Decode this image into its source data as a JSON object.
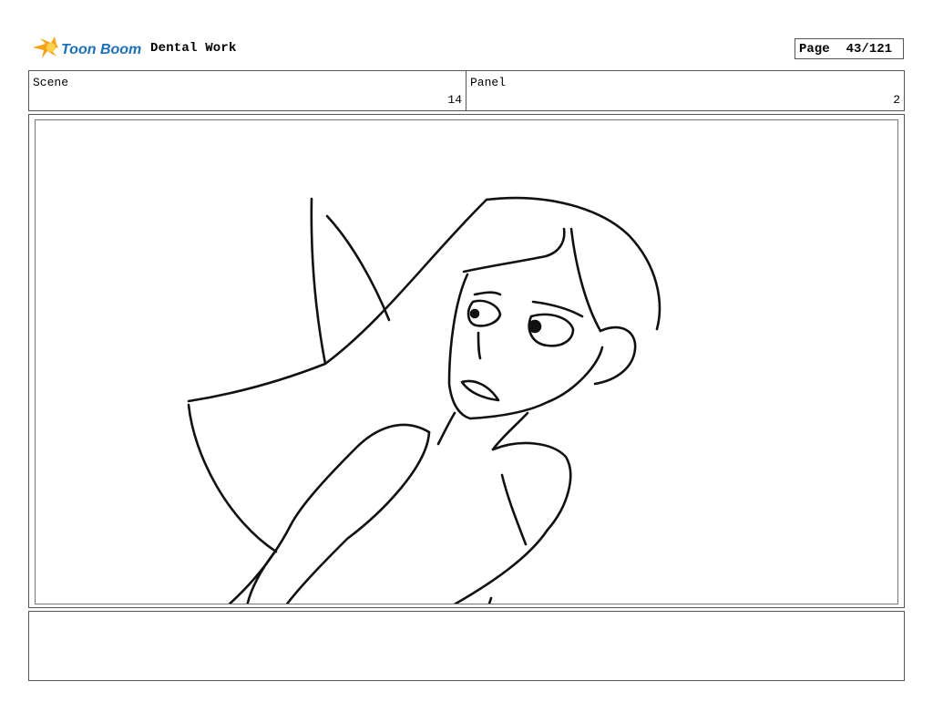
{
  "header": {
    "brand": "Toon Boom",
    "project_title": "Dental Work",
    "page_label": "Page",
    "page_number": "43/121"
  },
  "panel_info": {
    "scene_label": "Scene",
    "scene_value": "14",
    "panel_label": "Panel",
    "panel_value": "2"
  },
  "drawing": {
    "subject": "sketch of a girl with long hair looking back over her shoulder"
  },
  "notes": {
    "text": ""
  },
  "colors": {
    "logo_orange": "#f5a31a",
    "logo_blue": "#1d6fb8",
    "border": "#555555"
  }
}
